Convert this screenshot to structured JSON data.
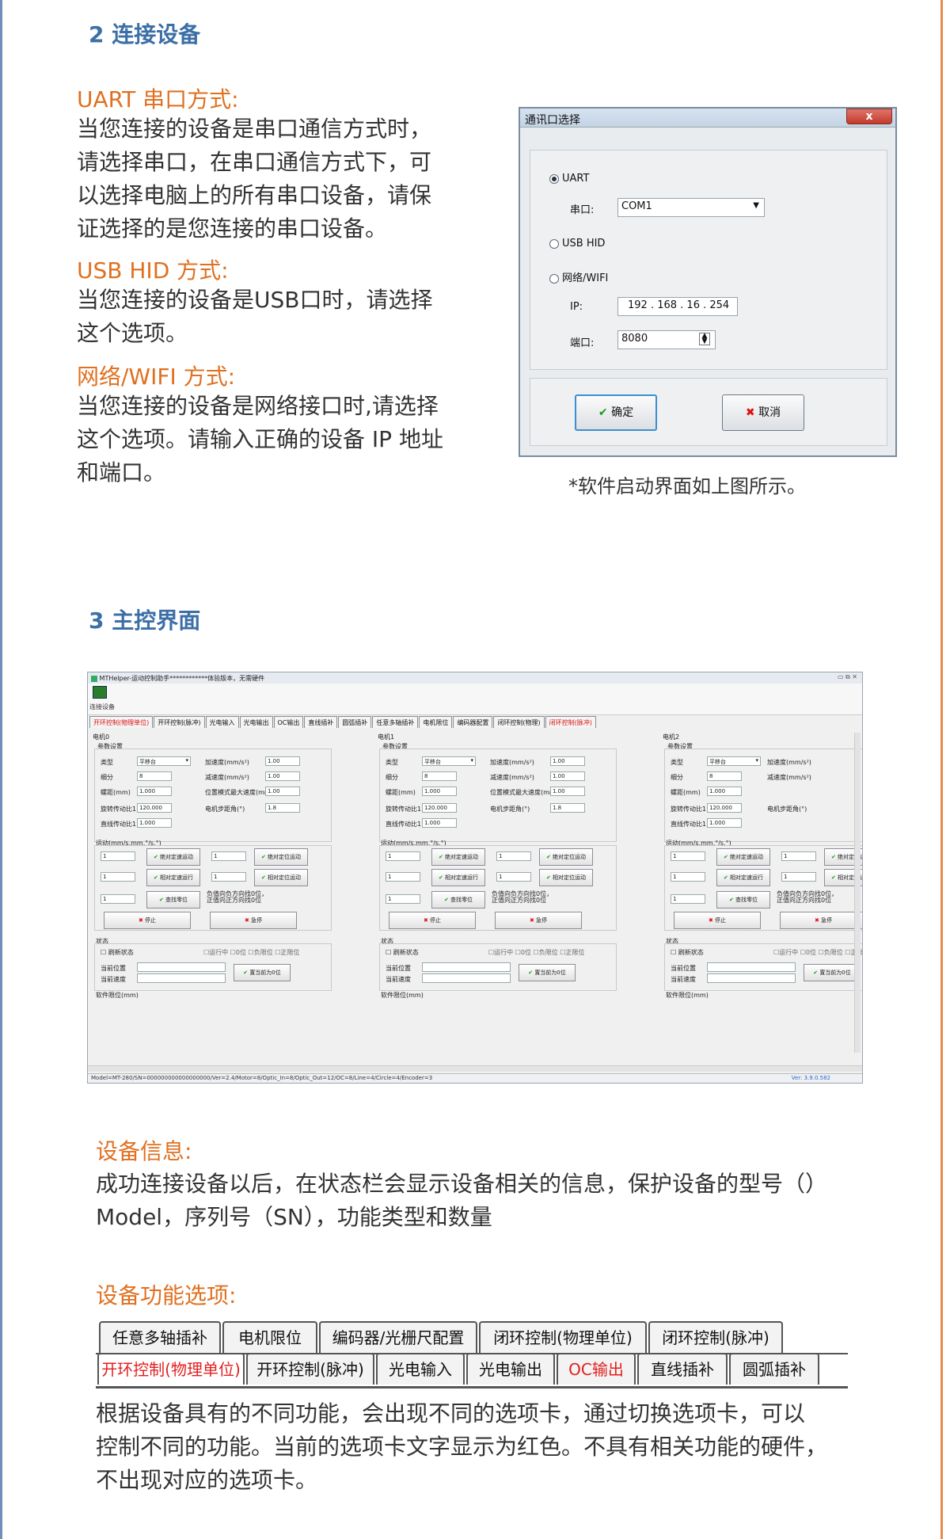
{
  "sec2": {
    "title": "2 连接设备",
    "uart_heading": "UART 串口方式:",
    "uart_text": [
      "当您连接的设备是串口通信方式时，",
      "请选择串口，在串口通信方式下，可",
      "以选择电脑上的所有串口设备，请保",
      "证选择的是您连接的串口设备。"
    ],
    "usb_heading": "USB HID 方式:",
    "usb_text": [
      "当您连接的设备是USB口时，请选择",
      "这个选项。"
    ],
    "net_heading": "网络/WIFI 方式:",
    "net_text": [
      "当您连接的设备是网络接口时,请选择",
      "这个选项。请输入正确的设备 IP 地址",
      "和端口。"
    ],
    "caption": "*软件启动界面如上图所示。"
  },
  "dialog": {
    "title": "通讯口选择",
    "close": "x",
    "uart": "UART",
    "port_label": "串口:",
    "port_value": "COM1",
    "usb": "USB HID",
    "net": "网络/WIFI",
    "ip_label": "IP:",
    "ip_value": "192  . 168  .  16   . 254",
    "netport_label": "端口:",
    "netport_value": "8080",
    "ok": "确定",
    "cancel": "取消"
  },
  "sec3": {
    "title": "3 主控界面"
  },
  "mainwin": {
    "title": "MTHelper-运动控制助手************体验版本，无需硬件",
    "toolbar_btn": "连接设备",
    "tabs": [
      "开环控制(物理单位)",
      "开环控制(脉冲)",
      "光电输入",
      "光电输出",
      "OC输出",
      "直线插补",
      "圆弧插补",
      "任意多轴插补",
      "电机限位",
      "编码器配置",
      "闭环控制(物理)",
      "闭环控制(脉冲)"
    ],
    "motors": [
      "电机0",
      "电机1",
      "电机2"
    ],
    "param_title": "参数设置",
    "type_label": "类型",
    "type_value": "平移台",
    "sub_label": "细分",
    "sub_value": "8",
    "pitch_label": "螺距(mm)",
    "pitch_value": "1.000",
    "rot_label": "旋转传动比1:",
    "rot_value": "120.000",
    "lin_label": "直线传动比1:",
    "lin_value": "1.000",
    "acc_label": "加速度(mm/s²)",
    "acc_value": "1.00",
    "dec_label": "减速度(mm/s²)",
    "dec_value": "1.00",
    "maxv_label": "位置模式最大速度(mm/s)",
    "maxv_value": "1.00",
    "step_label": "电机步距角(°)",
    "step_value": "1.8",
    "motion_title": "运动(mm/s,mm,°/s,°)",
    "b_abs_speed": "绝对定速运动",
    "b_abs_pos": "绝对定位运动",
    "b_rel_speed": "相对定速运行",
    "b_rel_pos": "相对定位运动",
    "b_home": "查找零位",
    "home_note": "负值向负方向找0位，正值向正方向找0位",
    "b_stop": "停止",
    "b_estop": "急停",
    "one": "1",
    "state_title": "状态",
    "refresh": "刷新状态",
    "running": "运行中",
    "zero": "0位",
    "neg_lim": "负限位",
    "pos_lim": "正限位",
    "cur_pos": "当前位置",
    "cur_speed": "当前速度",
    "set_zero": "置当前为0位",
    "soft_limit": "软件限位(mm)",
    "status_bar": "Model=MT-280/SN=000000000000000000/Ver=2.4/Motor=8/Optic_In=8/Optic_Out=12/OC=8/Line=4/Circle=4/Encoder=3",
    "version": "Ver: 3.9.0.582"
  },
  "devinfo": {
    "heading": "设备信息:",
    "text": [
      "成功连接设备以后，在状态栏会显示设备相关的信息，保护设备的型号（）",
      "Model，序列号（SN），功能类型和数量"
    ]
  },
  "devfunc": {
    "heading": "设备功能选项:",
    "tabs_back": [
      "任意多轴插补",
      "电机限位",
      "编码器/光栅尺配置",
      "闭环控制(物理单位)",
      "闭环控制(脉冲)"
    ],
    "tabs_front": [
      "开环控制(物理单位)",
      "开环控制(脉冲)",
      "光电输入",
      "光电输出",
      "OC输出",
      "直线插补",
      "圆弧插补"
    ],
    "text": [
      "根据设备具有的不同功能，会出现不同的选项卡，通过切换选项卡，可以",
      "控制不同的功能。当前的选项卡文字显示为红色。不具有相关功能的硬件，",
      "不出现对应的选项卡。"
    ]
  }
}
